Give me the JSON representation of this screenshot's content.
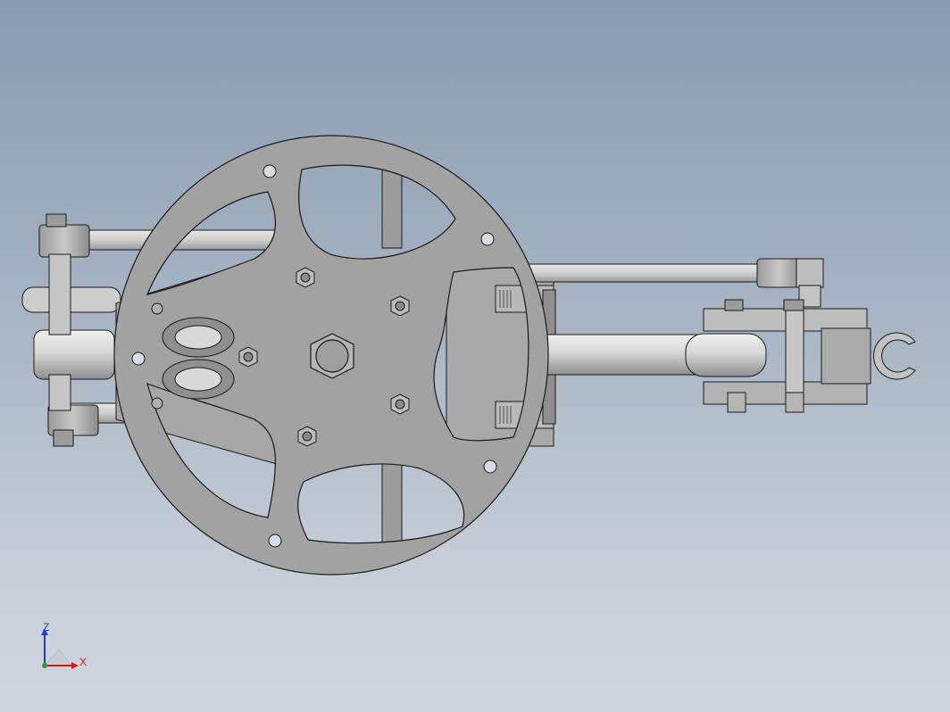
{
  "viewport": {
    "background_top": "#8a9bb0",
    "background_bottom": "#d0d6de",
    "model_color": "#a3a3a3",
    "edge_color": "#1a1a1a"
  },
  "triad": {
    "z_label": "Z",
    "x_label": "X",
    "z_color": "#1f3fd6",
    "x_color": "#d21a1a"
  }
}
